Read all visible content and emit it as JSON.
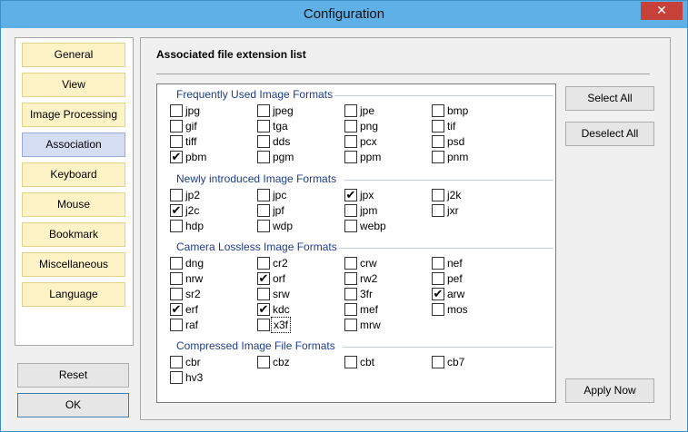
{
  "window": {
    "title": "Configuration",
    "close_glyph": "✕"
  },
  "sidebar": {
    "items": [
      "General",
      "View",
      "Image Processing",
      "Association",
      "Keyboard",
      "Mouse",
      "Bookmark",
      "Miscellaneous",
      "Language"
    ],
    "selected": "Association",
    "reset_label": "Reset",
    "ok_label": "OK"
  },
  "main": {
    "title": "Associated file extension list",
    "select_all_label": "Select All",
    "deselect_all_label": "Deselect All",
    "apply_now_label": "Apply Now"
  },
  "groups": [
    {
      "title": "Frequently Used Image Formats",
      "items": [
        {
          "ext": "jpg",
          "checked": false
        },
        {
          "ext": "jpeg",
          "checked": false
        },
        {
          "ext": "jpe",
          "checked": false
        },
        {
          "ext": "bmp",
          "checked": false
        },
        {
          "ext": "gif",
          "checked": false
        },
        {
          "ext": "tga",
          "checked": false
        },
        {
          "ext": "png",
          "checked": false
        },
        {
          "ext": "tif",
          "checked": false
        },
        {
          "ext": "tiff",
          "checked": false
        },
        {
          "ext": "dds",
          "checked": false
        },
        {
          "ext": "pcx",
          "checked": false
        },
        {
          "ext": "psd",
          "checked": false
        },
        {
          "ext": "pbm",
          "checked": true
        },
        {
          "ext": "pgm",
          "checked": false
        },
        {
          "ext": "ppm",
          "checked": false
        },
        {
          "ext": "pnm",
          "checked": false
        }
      ]
    },
    {
      "title": "Newly introduced Image Formats",
      "items": [
        {
          "ext": "jp2",
          "checked": false
        },
        {
          "ext": "jpc",
          "checked": false
        },
        {
          "ext": "jpx",
          "checked": true
        },
        {
          "ext": "j2k",
          "checked": false
        },
        {
          "ext": "j2c",
          "checked": true
        },
        {
          "ext": "jpf",
          "checked": false
        },
        {
          "ext": "jpm",
          "checked": false
        },
        {
          "ext": "jxr",
          "checked": false
        },
        {
          "ext": "hdp",
          "checked": false
        },
        {
          "ext": "wdp",
          "checked": false
        },
        {
          "ext": "webp",
          "checked": false
        }
      ]
    },
    {
      "title": "Camera Lossless Image Formats",
      "items": [
        {
          "ext": "dng",
          "checked": false
        },
        {
          "ext": "cr2",
          "checked": false
        },
        {
          "ext": "crw",
          "checked": false
        },
        {
          "ext": "nef",
          "checked": false
        },
        {
          "ext": "nrw",
          "checked": false
        },
        {
          "ext": "orf",
          "checked": true
        },
        {
          "ext": "rw2",
          "checked": false
        },
        {
          "ext": "pef",
          "checked": false
        },
        {
          "ext": "sr2",
          "checked": false
        },
        {
          "ext": "srw",
          "checked": false
        },
        {
          "ext": "3fr",
          "checked": false
        },
        {
          "ext": "arw",
          "checked": true
        },
        {
          "ext": "erf",
          "checked": true
        },
        {
          "ext": "kdc",
          "checked": true
        },
        {
          "ext": "mef",
          "checked": false
        },
        {
          "ext": "mos",
          "checked": false
        },
        {
          "ext": "raf",
          "checked": false
        },
        {
          "ext": "x3f",
          "checked": false,
          "focused": true
        },
        {
          "ext": "mrw",
          "checked": false
        }
      ]
    },
    {
      "title": "Compressed Image File Formats",
      "items": [
        {
          "ext": "cbr",
          "checked": false
        },
        {
          "ext": "cbz",
          "checked": false
        },
        {
          "ext": "cbt",
          "checked": false
        },
        {
          "ext": "cb7",
          "checked": false
        },
        {
          "ext": "hv3",
          "checked": false
        }
      ]
    }
  ]
}
